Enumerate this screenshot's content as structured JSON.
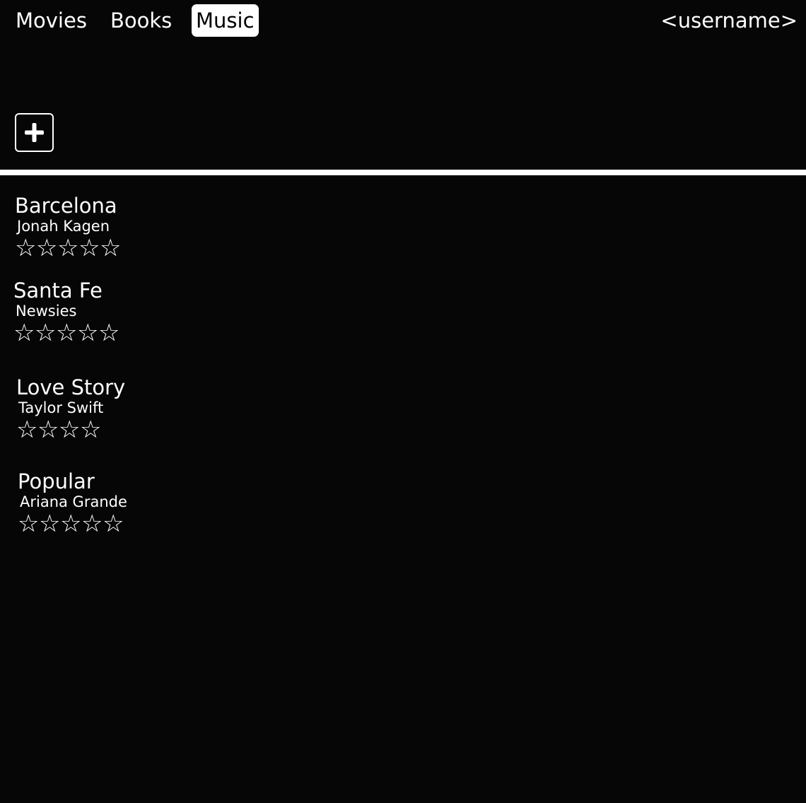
{
  "nav": {
    "tabs": [
      {
        "label": "Movies",
        "active": false
      },
      {
        "label": "Books",
        "active": false
      },
      {
        "label": "Music",
        "active": true
      }
    ],
    "username": "<username>"
  },
  "add_button": {
    "icon": "plus-icon"
  },
  "songs": [
    {
      "title": "Barcelona",
      "artist": "Jonah Kagen",
      "max_rating": 5,
      "rating": 0
    },
    {
      "title": "Santa Fe",
      "artist": "Newsies",
      "max_rating": 5,
      "rating": 0
    },
    {
      "title": "Love Story",
      "artist": "Taylor Swift",
      "max_rating": 4,
      "rating": 0
    },
    {
      "title": "Popular",
      "artist": "Ariana Grande",
      "max_rating": 5,
      "rating": 0
    }
  ],
  "colors": {
    "background": "#060606",
    "foreground": "#ffffff",
    "active_tab_text": "#000000"
  },
  "star_glyph": "☆"
}
